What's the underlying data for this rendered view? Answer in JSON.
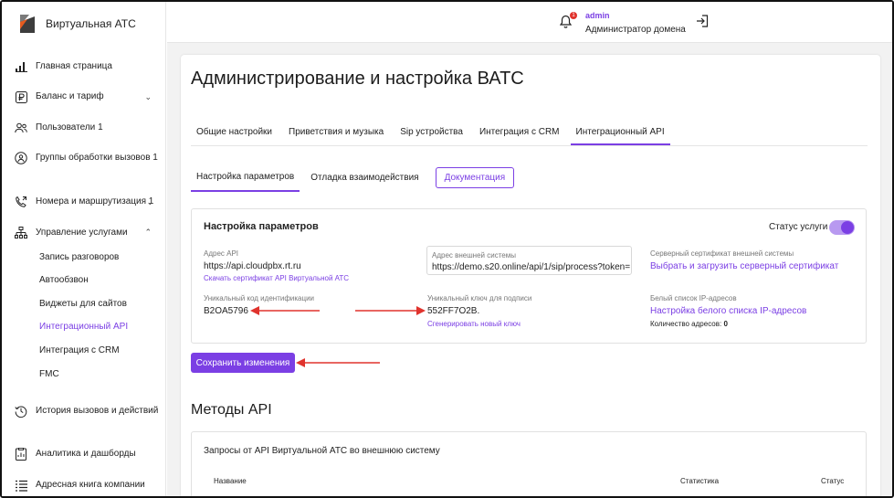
{
  "app": {
    "title": "Виртуальная АТС"
  },
  "sidebar": {
    "items": [
      {
        "label": "Главная страница",
        "icon": "chart-bars-icon"
      },
      {
        "label": "Баланс и тариф",
        "icon": "ruble-icon"
      },
      {
        "label": "Пользователи",
        "count": "1",
        "icon": "users-icon"
      },
      {
        "label": "Группы обработки вызовов",
        "count": "1",
        "icon": "group-call-icon"
      },
      {
        "label": "Номера и маршрутизация",
        "count": "1",
        "icon": "phone-route-icon"
      },
      {
        "label": "Управление услугами",
        "icon": "services-tree-icon"
      },
      {
        "label": "История вызовов и действий",
        "icon": "history-icon"
      },
      {
        "label": "Аналитика и дашборды",
        "icon": "analytics-icon"
      },
      {
        "label": "Адресная книга компании",
        "icon": "address-book-icon"
      }
    ],
    "sub_items": [
      {
        "label": "Запись разговоров"
      },
      {
        "label": "Автообзвон"
      },
      {
        "label": "Виджеты для сайтов"
      },
      {
        "label": "Интеграционный API"
      },
      {
        "label": "Интеграция с CRM"
      },
      {
        "label": "FMC"
      }
    ]
  },
  "header": {
    "notification_count": "1",
    "user_name": "admin",
    "user_role": "Администратор домена"
  },
  "main": {
    "title": "Администрирование и настройка ВАТС",
    "tabs": [
      {
        "label": "Общие настройки"
      },
      {
        "label": "Приветствия и музыка"
      },
      {
        "label": "Sip устройства"
      },
      {
        "label": "Интеграция с CRM"
      },
      {
        "label": "Интеграционный API"
      }
    ],
    "subtabs": [
      {
        "label": "Настройка параметров"
      },
      {
        "label": "Отладка взаимодействия"
      }
    ],
    "doc_button": "Документация",
    "panel": {
      "title": "Настройка параметров",
      "status_label": "Статус услуги",
      "api_address_label": "Адрес API",
      "api_address_value": "https://api.cloudpbx.rt.ru",
      "download_cert_link": "Скачать сертификат API Виртуальной АТС",
      "ext_system_label": "Адрес внешней системы",
      "ext_system_value": "https://demo.s20.online/api/1/sip/process?token=",
      "server_cert_label": "Серверный сертификат внешней системы",
      "server_cert_link": "Выбрать и загрузить серверный сертификат",
      "unique_id_label": "Уникальный код идентификации",
      "unique_id_value": "B2OA5796",
      "sign_key_label": "Уникальный ключ для подписи",
      "sign_key_value": "552FF7O2B.",
      "generate_key_link": "Сгенерировать новый ключ",
      "whitelist_label": "Белый список IP-адресов",
      "whitelist_link": "Настройка белого списка IP-адресов",
      "address_count_label": "Количество адресов:",
      "address_count_value": "0"
    },
    "save_button": "Сохранить изменения",
    "methods": {
      "title": "Методы API",
      "subtitle": "Запросы от API Виртуальной АТС во внешнюю систему",
      "columns": [
        "Название",
        "Статистика",
        "Статус"
      ]
    }
  },
  "colors": {
    "accent": "#7b3fe4",
    "arrow": "#e0332d"
  }
}
